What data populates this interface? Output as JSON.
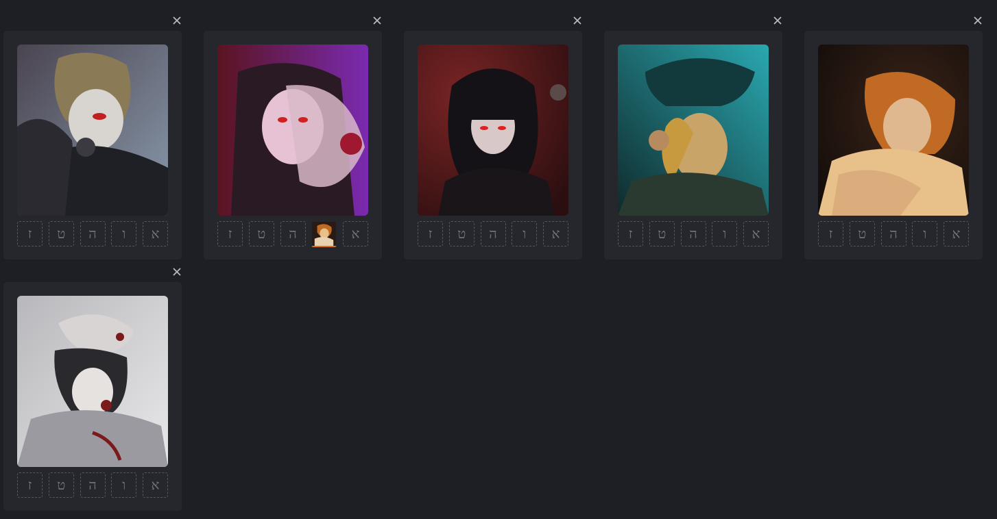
{
  "cards": [
    {
      "slots": [
        "ז",
        "ט",
        "ה",
        "ו",
        "א"
      ],
      "filled_slot_index": null,
      "portrait_colors": [
        "#3a3440",
        "#8a7a55",
        "#b8c2cf"
      ],
      "close_icon": "close-icon"
    },
    {
      "slots": [
        "ז",
        "ט",
        "ה",
        "",
        "א"
      ],
      "filled_slot_index": 3,
      "portrait_colors": [
        "#5a1420",
        "#7a2ab0",
        "#e6c2d4"
      ],
      "close_icon": "close-icon"
    },
    {
      "slots": [
        "ז",
        "ט",
        "ה",
        "ו",
        "א"
      ],
      "filled_slot_index": null,
      "portrait_colors": [
        "#3a1414",
        "#7a2424",
        "#1a1518"
      ],
      "close_icon": "close-icon"
    },
    {
      "slots": [
        "ז",
        "ט",
        "ה",
        "ו",
        "א"
      ],
      "filled_slot_index": null,
      "portrait_colors": [
        "#0f3a3c",
        "#2aa8b0",
        "#c89a40"
      ],
      "close_icon": "close-icon"
    },
    {
      "slots": [
        "ז",
        "ט",
        "ה",
        "ו",
        "א"
      ],
      "filled_slot_index": null,
      "portrait_colors": [
        "#1a1210",
        "#c06a24",
        "#e8c08a"
      ],
      "close_icon": "close-icon"
    },
    {
      "slots": [
        "ז",
        "ט",
        "ה",
        "ו",
        "א"
      ],
      "filled_slot_index": null,
      "portrait_colors": [
        "#e0e0e2",
        "#9a9aa0",
        "#7a1a1a"
      ],
      "close_icon": "close-icon"
    }
  ],
  "colors": {
    "background": "#1e1f24",
    "card": "#26272c",
    "slot_border": "#55575e",
    "slot_text": "#707279",
    "filled_accent": "#e0701f"
  }
}
